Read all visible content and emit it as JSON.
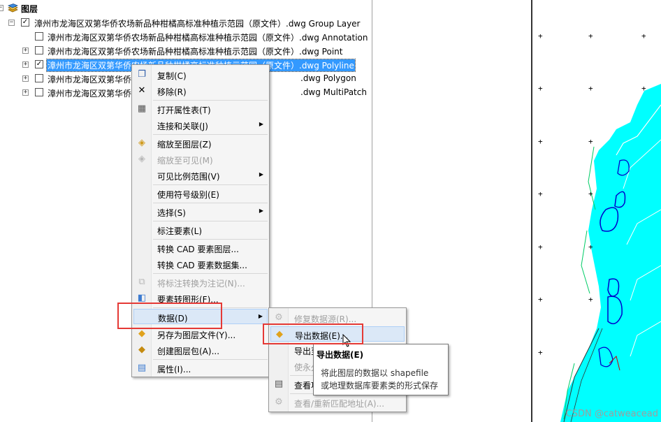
{
  "toc": {
    "root_label": "图层",
    "group_layer": "漳州市龙海区双第华侨农场新品种柑橘高标准种植示范园（原文件）.dwg Group Layer",
    "layers": [
      {
        "label": "漳州市龙海区双第华侨农场新品种柑橘高标准种植示范园（原文件）.dwg Annotation",
        "checked": false
      },
      {
        "label": "漳州市龙海区双第华侨农场新品种柑橘高标准种植示范园（原文件）.dwg Point",
        "checked": false
      },
      {
        "label": "漳州市龙海区双第华侨农场新品种柑橘高标准种植示范园（原文件）.dwg Polyline",
        "checked": true
      },
      {
        "label": "漳州市龙海区双第华侨",
        "tail": ".dwg Polygon",
        "checked": false
      },
      {
        "label": "漳州市龙海区双第华侨",
        "tail": ".dwg MultiPatch",
        "checked": false
      }
    ],
    "expander_plus": "+",
    "expander_minus": "−",
    "check_mark": "✓"
  },
  "context_menu": {
    "items": [
      {
        "label": "复制(C)",
        "icon": "copy-icon",
        "glyph": "❐"
      },
      {
        "label": "移除(R)",
        "icon": "remove-icon",
        "glyph": "✕"
      },
      {
        "label": "打开属性表(T)",
        "icon": "table-icon",
        "glyph": "▦"
      },
      {
        "label": "连接和关联(J)",
        "submenu": true
      },
      {
        "label": "缩放至图层(Z)",
        "icon": "zoom-layer-icon",
        "glyph": "◈"
      },
      {
        "label": "缩放至可见(M)",
        "disabled": true,
        "icon": "zoom-visible-icon",
        "glyph": "◈"
      },
      {
        "label": "可见比例范围(V)",
        "submenu": true
      },
      {
        "label": "使用符号级别(E)"
      },
      {
        "label": "选择(S)",
        "submenu": true
      },
      {
        "label": "标注要素(L)"
      },
      {
        "label": "转换 CAD 要素图层..."
      },
      {
        "label": "转换 CAD 要素数据集..."
      },
      {
        "label": "将标注转换为注记(N)...",
        "disabled": true,
        "icon": "annotation-icon",
        "glyph": "⧉"
      },
      {
        "label": "要素转图形(F)...",
        "icon": "graphics-icon",
        "glyph": "◧"
      },
      {
        "label": "数据(D)",
        "submenu": true,
        "highlight": true
      },
      {
        "label": "另存为图层文件(Y)...",
        "icon": "layer-file-icon",
        "glyph": "◆"
      },
      {
        "label": "创建图层包(A)...",
        "icon": "layer-package-icon",
        "glyph": "◆"
      },
      {
        "label": "属性(I)...",
        "icon": "properties-icon",
        "glyph": "▤"
      }
    ],
    "arrow_glyph": "▶"
  },
  "sub_menu": {
    "items": [
      {
        "label": "修复数据源(R)...",
        "disabled": true,
        "icon": "repair-icon",
        "glyph": "⚙"
      },
      {
        "label": "导出数据(E)...",
        "highlight": true,
        "icon": "export-icon",
        "glyph": "◆"
      },
      {
        "label": "导出至"
      },
      {
        "label": "使永久",
        "disabled": true
      },
      {
        "label": "查看项",
        "icon": "view-icon",
        "glyph": "▤"
      },
      {
        "label": "查看/重新匹配地址(A)...",
        "disabled": true,
        "icon": "rematch-icon",
        "glyph": "⚙"
      }
    ]
  },
  "tooltip": {
    "title": "导出数据(E)",
    "line1": "将此图层的数据以 shapefile",
    "line2": "或地理数据库要素类的形式保存"
  },
  "map": {
    "plus_marker": "+",
    "fill_color": "#00ffff",
    "line_color": "#0000cc"
  },
  "watermark": "CSDN @catweacead"
}
